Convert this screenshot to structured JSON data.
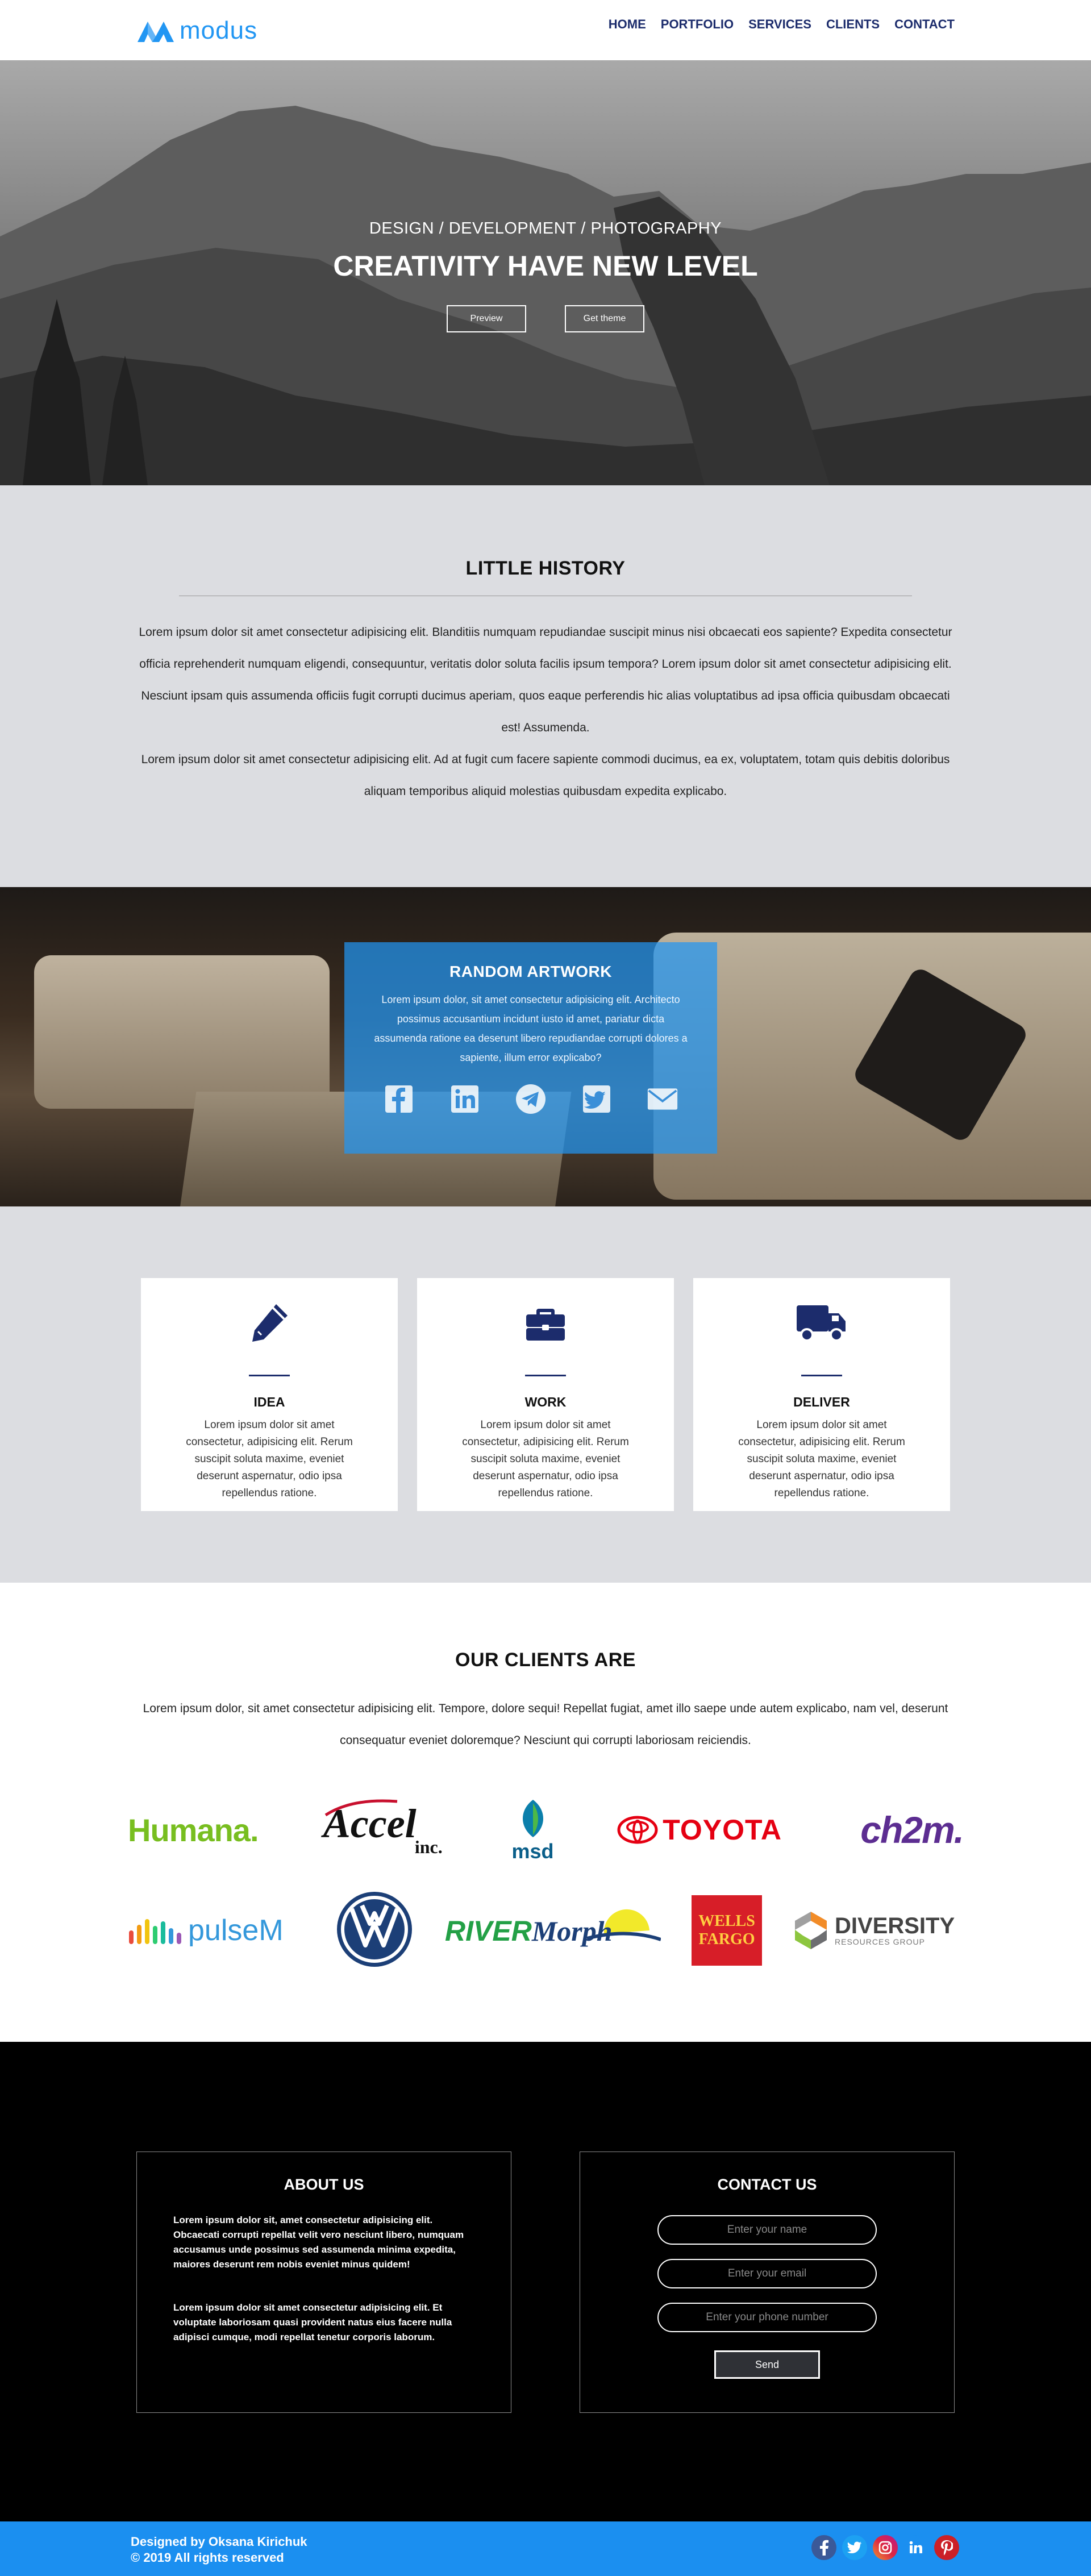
{
  "header": {
    "logo_text": "modus",
    "nav": [
      "HOME",
      "PORTFOLIO",
      "SERVICES",
      "CLIENTS",
      "CONTACT"
    ]
  },
  "hero": {
    "subtitle": "DESIGN / DEVELOPMENT / PHOTOGRAPHY",
    "title": "CREATIVITY HAVE NEW LEVEL",
    "btn_preview": "Preview",
    "btn_theme": "Get theme"
  },
  "history": {
    "title": "LITTLE HISTORY",
    "p1": "Lorem ipsum dolor sit amet consectetur adipisicing elit. Blanditiis numquam repudiandae suscipit minus nisi obcaecati eos sapiente? Expedita consectetur officia reprehenderit numquam eligendi, consequuntur, veritatis dolor soluta facilis ipsum tempora? Lorem ipsum dolor sit amet consectetur adipisicing elit. Nesciunt ipsam quis assumenda officiis fugit corrupti ducimus aperiam, quos eaque perferendis hic alias voluptatibus ad ipsa officia quibusdam obcaecati est! Assumenda.",
    "p2": "Lorem ipsum dolor sit amet consectetur adipisicing elit. Ad at fugit cum facere sapiente commodi ducimus, ea ex, voluptatem, totam quis debitis doloribus aliquam temporibus aliquid molestias quibusdam expedita explicabo."
  },
  "artwork": {
    "title": "RANDOM ARTWORK",
    "text": "Lorem ipsum dolor, sit amet consectetur adipisicing elit. Architecto possimus accusantium incidunt iusto id amet, pariatur dicta assumenda ratione ea deserunt libero repudiandae corrupti dolores a sapiente, illum error explicabo?",
    "icons": [
      "facebook-icon",
      "linkedin-icon",
      "telegram-icon",
      "twitter-icon",
      "email-icon"
    ]
  },
  "features": {
    "cards": [
      {
        "icon": "pencil-icon",
        "title": "IDEA",
        "text": "Lorem ipsum dolor sit amet consectetur, adipisicing elit. Rerum suscipit soluta maxime, eveniet deserunt aspernatur, odio ipsa repellendus ratione."
      },
      {
        "icon": "briefcase-icon",
        "title": "WORK",
        "text": "Lorem ipsum dolor sit amet consectetur, adipisicing elit. Rerum suscipit soluta maxime, eveniet deserunt aspernatur, odio ipsa repellendus ratione."
      },
      {
        "icon": "truck-icon",
        "title": "DELIVER",
        "text": "Lorem ipsum dolor sit amet consectetur, adipisicing elit. Rerum suscipit soluta maxime, eveniet deserunt aspernatur, odio ipsa repellendus ratione."
      }
    ]
  },
  "clients": {
    "title": "OUR CLIENTS ARE",
    "text": "Lorem ipsum dolor, sit amet consectetur adipisicing elit. Tempore, dolore sequi! Repellat fugiat, amet illo saepe unde autem explicabo, nam vel, deserunt consequatur eveniet doloremque? Nesciunt qui corrupti laboriosam reiciendis.",
    "logos": {
      "humana": "Humana.",
      "accel": "Accel",
      "accel_sub": "inc.",
      "msd": "msd",
      "toyota": "TOYOTA",
      "ch2m": "ch2m.",
      "pulsem": "pulseM",
      "rivermorph": "RIVER",
      "rivermorph2": "Morph",
      "wells": "WELLS",
      "fargo": "FARGO",
      "diversity": "DIVERSITY",
      "diversity_sub": "RESOURCES GROUP"
    }
  },
  "footer": {
    "about_title": "ABOUT US",
    "about_p1": "Lorem ipsum dolor sit, amet consectetur adipisicing elit. Obcaecati corrupti repellat velit vero nesciunt libero, numquam accusamus unde possimus sed assumenda minima expedita, maiores deserunt rem nobis eveniet minus quidem!",
    "about_p2": "Lorem ipsum dolor sit amet consectetur adipisicing elit. Et voluptate laboriosam quasi provident natus eius facere nulla adipisci cumque, modi repellat tenetur corporis laborum.",
    "contact_title": "CONTACT US",
    "name_placeholder": "Enter your name",
    "email_placeholder": "Enter your email",
    "phone_placeholder": "Enter your phone number",
    "send_label": "Send"
  },
  "bottom": {
    "designed_by": "Designed by Oksana Kirichuk",
    "copyright": "© 2019 All rights reserved",
    "icons": [
      "facebook-icon",
      "twitter-icon",
      "instagram-icon",
      "linkedin-icon",
      "pinterest-icon"
    ]
  },
  "colors": {
    "accent": "#2196f3",
    "navy": "#1c2c6c",
    "section_gray": "#dcdde1"
  }
}
